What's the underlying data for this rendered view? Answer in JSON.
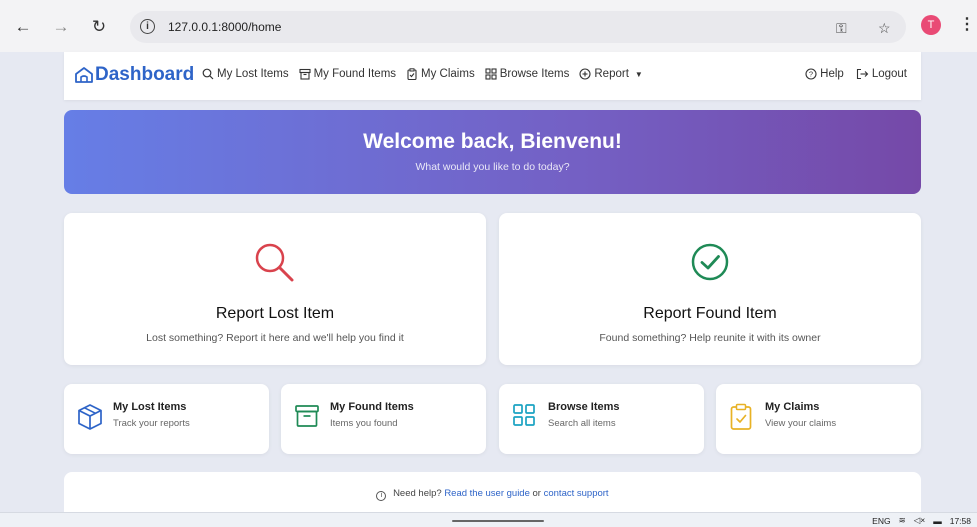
{
  "browser": {
    "url": "127.0.0.1:8000/home",
    "avatar_initial": "T"
  },
  "navbar": {
    "brand": "Dashboard",
    "items": [
      {
        "label": "My Lost Items",
        "icon": "search-icon"
      },
      {
        "label": "My Found Items",
        "icon": "archive-icon"
      },
      {
        "label": "My Claims",
        "icon": "clipboard-icon"
      },
      {
        "label": "Browse Items",
        "icon": "grid-icon"
      },
      {
        "label": "Report",
        "icon": "plus-circle-icon"
      }
    ],
    "help": "Help",
    "logout": "Logout"
  },
  "banner": {
    "title": "Welcome back, Bienvenu!",
    "subtitle": "What would you like to do today?"
  },
  "cards": {
    "report_lost": {
      "title": "Report Lost Item",
      "desc": "Lost something? Report it here and we'll help you find it"
    },
    "report_found": {
      "title": "Report Found Item",
      "desc": "Found something? Help reunite it with its owner"
    }
  },
  "quick_links": [
    {
      "title": "My Lost Items",
      "sub": "Track your reports",
      "icon": "box-icon"
    },
    {
      "title": "My Found Items",
      "sub": "Items you found",
      "icon": "archive-icon"
    },
    {
      "title": "Browse Items",
      "sub": "Search all items",
      "icon": "grid-icon"
    },
    {
      "title": "My Claims",
      "sub": "View your claims",
      "icon": "clipboard-check-icon"
    }
  ],
  "help": {
    "prefix": "Need help?",
    "guide_link": "Read the user guide",
    "or": "or",
    "support_link": "contact support"
  },
  "taskbar": {
    "lang": "ENG",
    "time": "17:58"
  },
  "colors": {
    "brand": "#2e64c8",
    "lost_icon": "#d9434d",
    "found_icon": "#1f8a56",
    "banner_start": "#667ee6",
    "banner_end": "#7549a8",
    "lost_small_icon": "#2e64c8",
    "found_small_icon": "#1f8a56",
    "browse_small_icon": "#1aa2c2",
    "claims_small_icon": "#e8b225"
  }
}
